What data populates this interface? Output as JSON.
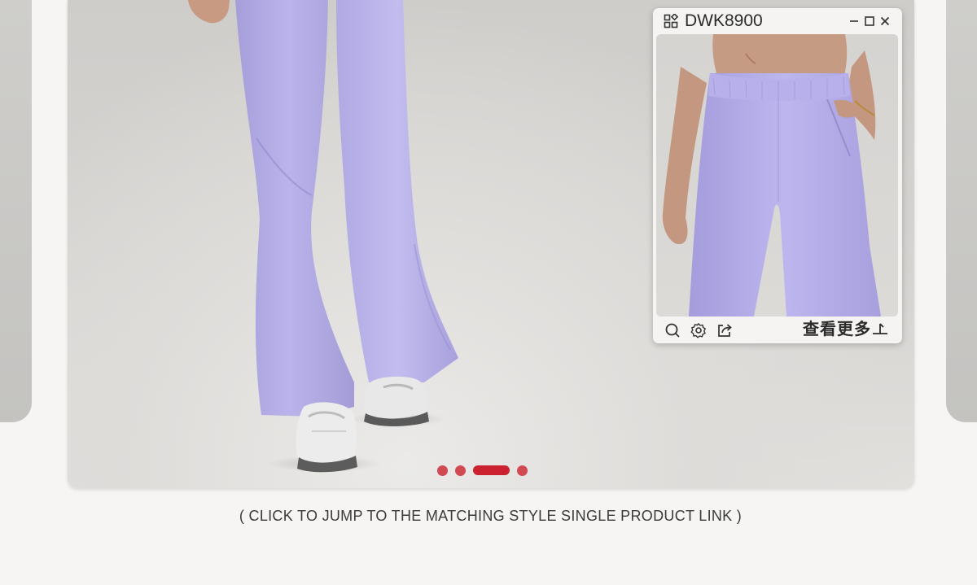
{
  "carousel": {
    "slide_count": 4,
    "active_index": 2,
    "dot_color": "#d14a52",
    "active_dot_color": "#cc2230"
  },
  "popup": {
    "title": "DWK8900",
    "more_label": "查看更多",
    "icons": {
      "header": "grid-apps-icon",
      "minimize": "minimize-icon",
      "maximize": "maximize-icon",
      "close": "close-icon",
      "tools": [
        "search-icon",
        "gear-icon",
        "share-icon"
      ],
      "more": "expand-arrow-icon"
    }
  },
  "caption": "( CLICK TO JUMP TO THE MATCHING STYLE SINGLE PRODUCT LINK )",
  "colors": {
    "page_background": "#f6f5f3",
    "garment_lavender": "#b6afe6"
  }
}
